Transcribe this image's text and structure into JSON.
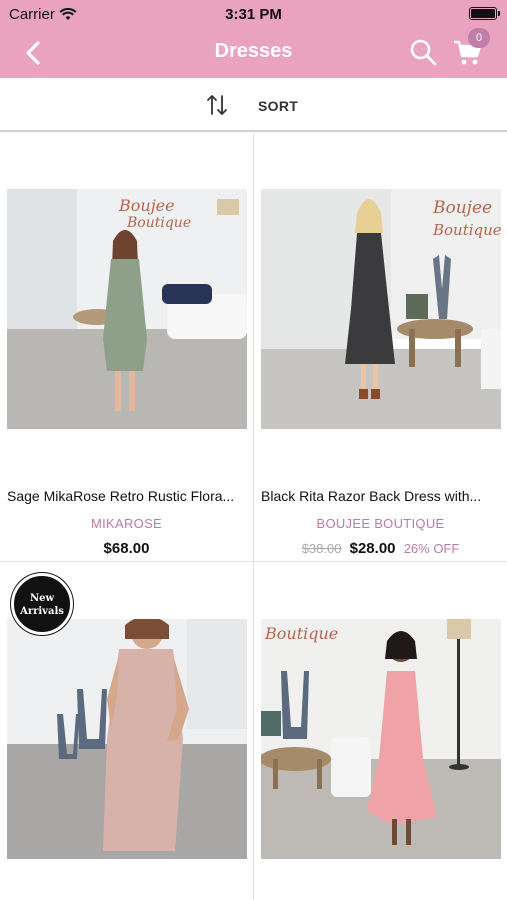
{
  "status_bar": {
    "carrier": "Carrier",
    "time": "3:31 PM"
  },
  "nav": {
    "title": "Dresses",
    "cart_count": "0"
  },
  "sort": {
    "label": "SORT"
  },
  "products": [
    {
      "name": "Sage MikaRose Retro Rustic Flora...",
      "brand": "MIKAROSE",
      "price": "$68.00",
      "old_price": "",
      "discount": ""
    },
    {
      "name": "Black Rita Razor Back Dress with...",
      "brand": "BOUJEE BOUTIQUE",
      "price": "$28.00",
      "old_price": "$38.00",
      "discount": "26% OFF"
    },
    {
      "name": "",
      "brand": "",
      "price": "",
      "old_price": "",
      "discount": "",
      "badge": [
        "New",
        "Arrivals"
      ]
    },
    {
      "name": "",
      "brand": "",
      "price": "",
      "old_price": "",
      "discount": ""
    }
  ],
  "images": {
    "p1_sign": [
      "Boujee",
      "Boutique"
    ],
    "p2_sign": [
      "Boujee",
      "Boutique"
    ],
    "p4_sign": "Boutique"
  },
  "colors": {
    "brand_pink": "#e9a3bf",
    "accent": "#b97ca6"
  },
  "icons": [
    "wifi-icon",
    "battery-icon",
    "back-chevron-icon",
    "search-icon",
    "cart-icon",
    "sort-arrows-icon"
  ]
}
